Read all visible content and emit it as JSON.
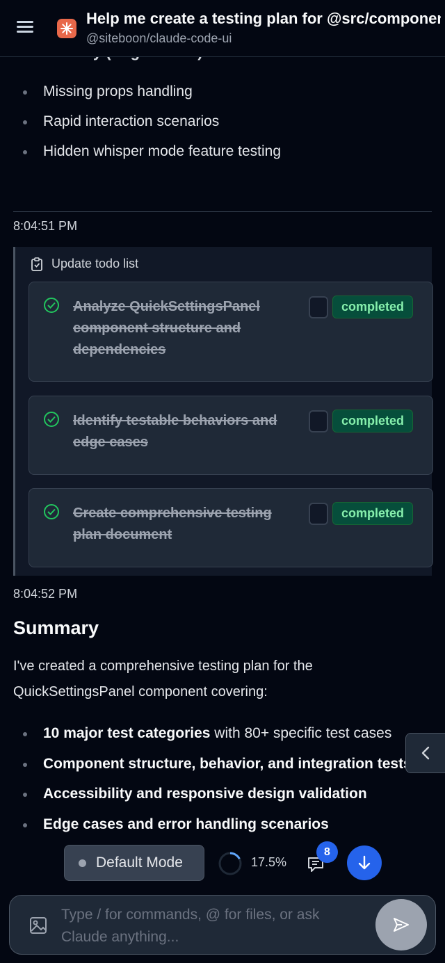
{
  "header": {
    "title": "Help me create a testing plan for @src/components/QuickSettingsPanel",
    "subtitle": "@siteboon/claude-code-ui",
    "cut_heading": "Low Priority (Edge Cases):"
  },
  "top_bullets": [
    "Missing props handling",
    "Rapid interaction scenarios",
    "Hidden whisper mode feature testing"
  ],
  "timestamp_1": "8:04:51 PM",
  "todo": {
    "header": "Update todo list",
    "items": [
      {
        "text": "Analyze QuickSettingsPanel component structure and dependencies",
        "status": "completed"
      },
      {
        "text": "Identify testable behaviors and edge cases",
        "status": "completed"
      },
      {
        "text": "Create comprehensive testing plan document",
        "status": "completed"
      }
    ]
  },
  "timestamp_2": "8:04:52 PM",
  "summary": {
    "title": "Summary",
    "text": "I've created a comprehensive testing plan for the QuickSettingsPanel component covering:",
    "bullets": [
      {
        "bold": "10 major test categories",
        "rest": " with 80+ specific test cases"
      },
      {
        "bold": "Component structure, behavior, and integration tests",
        "rest": ""
      },
      {
        "bold": "Accessibility and responsive design validation",
        "rest": ""
      },
      {
        "bold": "Edge cases and error handling scenarios",
        "rest": ""
      }
    ]
  },
  "toolbar": {
    "mode_label": "Default Mode",
    "progress": 17.5,
    "progress_text": "17.5%",
    "chat_badge": "8"
  },
  "input": {
    "placeholder": "Type / for commands, @ for files, or ask Claude anything..."
  },
  "colors": {
    "accent": "#2563eb",
    "success": "#22c55e",
    "logo": "#e8684a"
  }
}
